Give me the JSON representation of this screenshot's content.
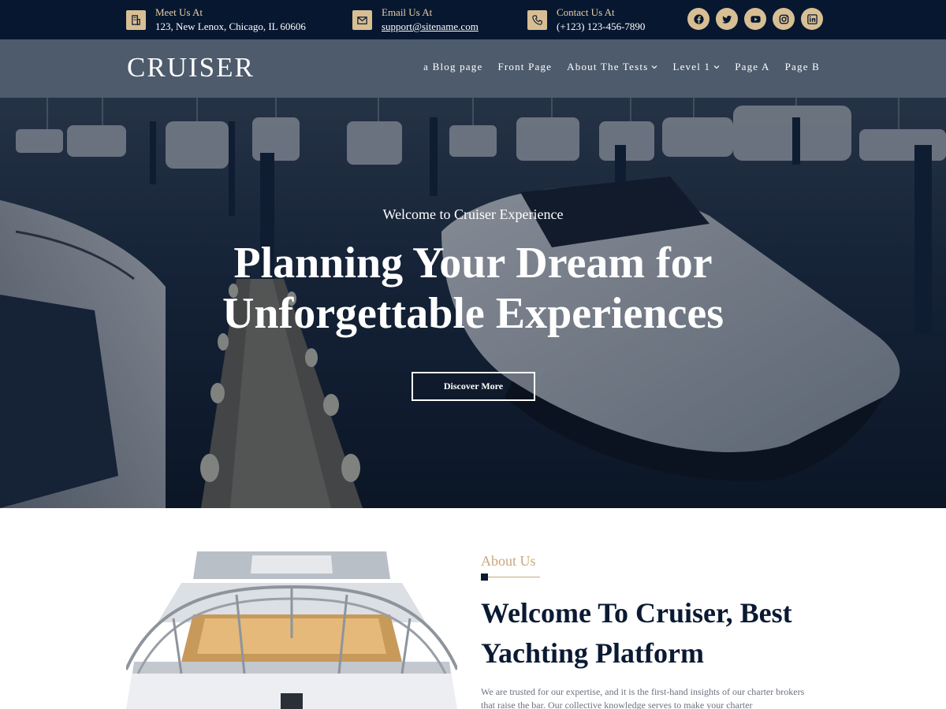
{
  "topbar": {
    "meet": {
      "title": "Meet Us At",
      "value": "123, New Lenox, Chicago, IL 60606",
      "icon": "building-icon"
    },
    "email": {
      "title": "Email Us At",
      "value": "support@sitename.com",
      "icon": "envelope-icon"
    },
    "contact": {
      "title": "Contact Us At",
      "value": "(+123) 123-456-7890",
      "icon": "phone-icon"
    },
    "socials": [
      "facebook-icon",
      "twitter-icon",
      "youtube-icon",
      "instagram-icon",
      "linkedin-icon"
    ]
  },
  "nav": {
    "logo": "CRUISER",
    "items": [
      {
        "label": "a Blog page",
        "has_dropdown": false
      },
      {
        "label": "Front Page",
        "has_dropdown": false
      },
      {
        "label": "About The Tests",
        "has_dropdown": true
      },
      {
        "label": "Level 1",
        "has_dropdown": true
      },
      {
        "label": "Page A",
        "has_dropdown": false
      },
      {
        "label": "Page B",
        "has_dropdown": false
      }
    ]
  },
  "hero": {
    "subtitle": "Welcome to Cruiser Experience",
    "title_line1": "Planning Your Dream for",
    "title_line2": "Unforgettable Experiences",
    "button": "Discover More"
  },
  "about": {
    "label": "About Us",
    "heading_line1": "Welcome To Cruiser, Best",
    "heading_line2": "Yachting Platform",
    "body": "We are trusted for our expertise, and it is the first-hand insights of our charter brokers that raise the bar. Our collective knowledge serves to make your charter"
  },
  "colors": {
    "topbar_bg": "#071730",
    "nav_bg": "#4d5b6c",
    "accent_gold": "#d8be93",
    "heading_navy": "#0b1a33"
  }
}
